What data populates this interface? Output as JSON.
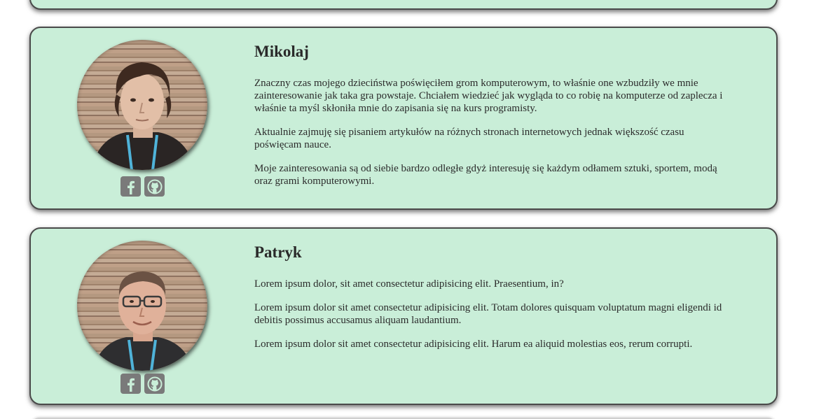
{
  "members": [
    {
      "name": "Mikolaj",
      "paragraphs": [
        "Znaczny czas mojego dzieciństwa poświęciłem grom komputerowym, to właśnie one wzbudziły we mnie zainteresowanie jak taka gra powstaje. Chciałem wiedzieć jak wygląda to co robię na komputerze od zaplecza i właśnie ta myśl skłoniła mnie do zapisania się na kurs programisty.",
        "Aktualnie zajmuję się pisaniem artykułów na różnych stronach internetowych jednak większość czasu poświęcam nauce.",
        "Moje zainteresowania są od siebie bardzo odległe gdyż interesuję się każdym odłamem sztuki, sportem, modą oraz grami komputerowymi."
      ],
      "social": [
        {
          "icon": "facebook-icon"
        },
        {
          "icon": "github-icon"
        }
      ]
    },
    {
      "name": "Patryk",
      "paragraphs": [
        "Lorem ipsum dolor, sit amet consectetur adipisicing elit. Praesentium, in?",
        "Lorem ipsum dolor sit amet consectetur adipisicing elit. Totam dolores quisquam voluptatum magni eligendi id debitis possimus accusamus aliquam laudantium.",
        "Lorem ipsum dolor sit amet consectetur adipisicing elit. Harum ea aliquid molestias eos, rerum corrupti."
      ],
      "social": [
        {
          "icon": "facebook-icon"
        },
        {
          "icon": "github-icon"
        }
      ]
    }
  ],
  "colors": {
    "card_background": "#c9eed8",
    "card_border": "#4a4a4a",
    "icon_background": "#7a7a7a"
  }
}
